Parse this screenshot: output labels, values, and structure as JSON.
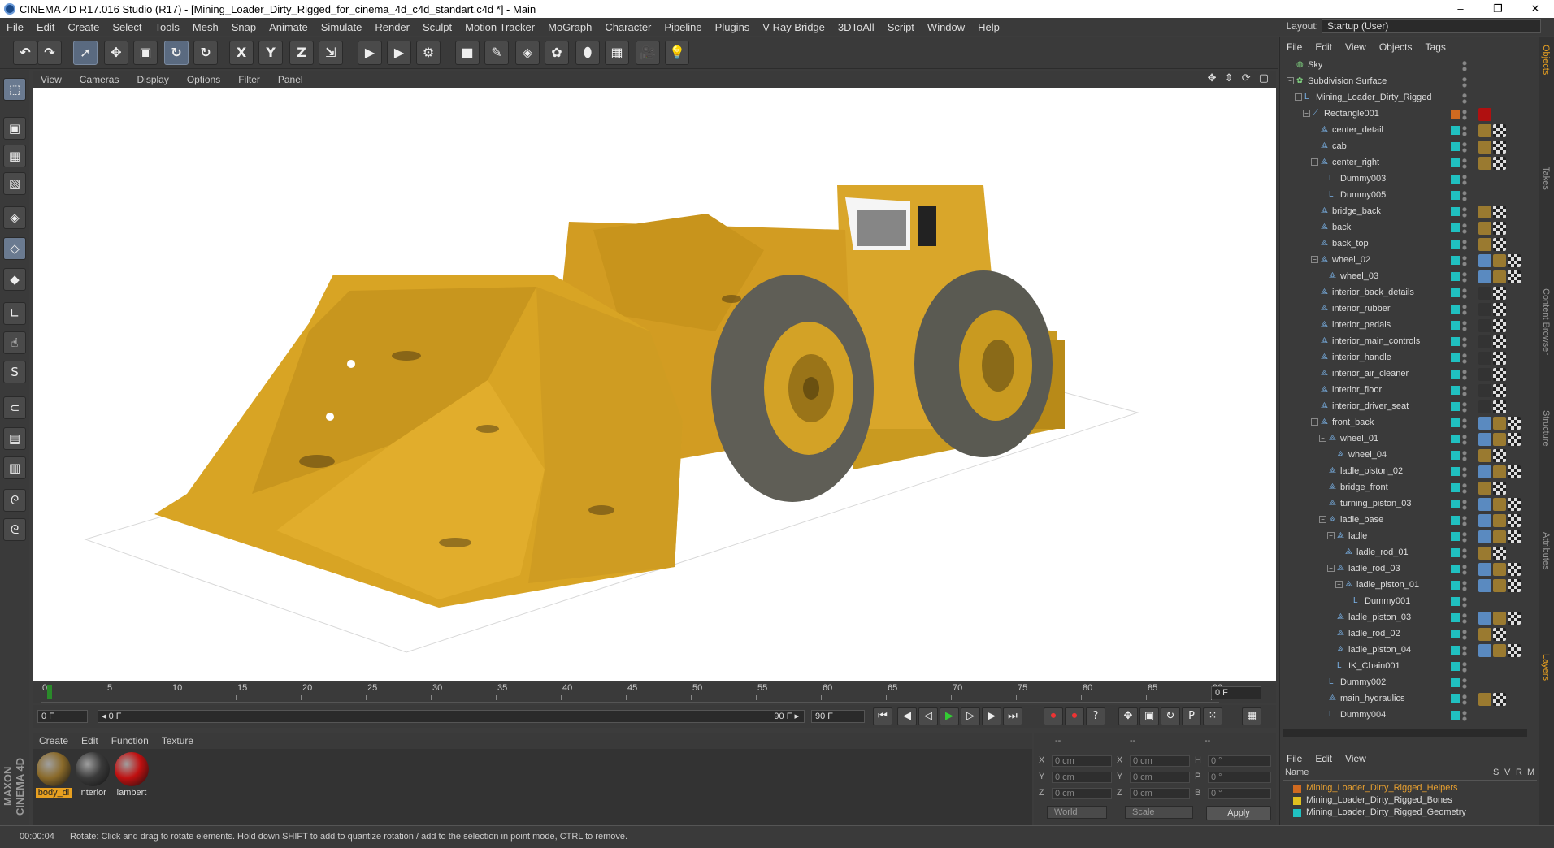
{
  "window": {
    "title": "CINEMA 4D R17.016 Studio (R17) - [Mining_Loader_Dirty_Rigged_for_cinema_4d_c4d_standart.c4d *] - Main",
    "controls": [
      "–",
      "❐",
      "✕"
    ]
  },
  "menubar": [
    "File",
    "Edit",
    "Create",
    "Select",
    "Tools",
    "Mesh",
    "Snap",
    "Animate",
    "Simulate",
    "Render",
    "Sculpt",
    "Motion Tracker",
    "MoGraph",
    "Character",
    "Pipeline",
    "Plugins",
    "V-Ray Bridge",
    "3DToAll",
    "Script",
    "Window",
    "Help"
  ],
  "layout": {
    "label": "Layout:",
    "value": "Startup (User)"
  },
  "toolbar": {
    "icons": [
      "undo-icon",
      "redo-icon",
      "live-select-icon",
      "move-icon",
      "scale-icon",
      "rotate-icon",
      "recent-tool-icon",
      "x-axis-icon",
      "y-axis-icon",
      "z-axis-icon",
      "coordinate-system-icon",
      "render-view-icon",
      "render-picture-viewer-icon",
      "edit-render-settings-icon",
      "cube-icon",
      "pen-icon",
      "subdivision-icon",
      "cloner-icon",
      "deformer-icon",
      "floor-icon",
      "camera-icon",
      "light-icon"
    ],
    "glyphs": [
      "↶",
      "↷",
      "➚",
      "✥",
      "▣",
      "↻",
      "↻",
      "X",
      "Y",
      "Z",
      "⇲",
      "▶",
      "▶",
      "⚙",
      "■",
      "✎",
      "◈",
      "✿",
      "⬮",
      "▦",
      "🎥",
      "💡"
    ]
  },
  "left_tools": {
    "icons": [
      "model-mode-icon",
      "make-editable-icon",
      "texture-mode-icon",
      "workplane-icon",
      "points-mode-icon",
      "edges-mode-icon",
      "polygons-mode-icon",
      "axis-mode-icon",
      "tweak-mode-icon",
      "solo-icon",
      "snap-icon",
      "workplane-lock-icon",
      "grid-snap-icon",
      "python-icon",
      "python-script-icon"
    ],
    "glyphs": [
      "⬚",
      "▣",
      "▦",
      "▧",
      "◈",
      "◇",
      "◆",
      "∟",
      "☝",
      "S",
      "⊂",
      "▤",
      "▥",
      "ᘓ",
      "ᘓ"
    ]
  },
  "maxon_logo": "MAXON CINEMA 4D",
  "viewport": {
    "menu": [
      "View",
      "Cameras",
      "Display",
      "Options",
      "Filter",
      "Panel"
    ],
    "nav_icons": "✥ ⇕ ⟳ ▢"
  },
  "timeline": {
    "ticks": [
      "0",
      "5",
      "10",
      "15",
      "20",
      "25",
      "30",
      "35",
      "40",
      "45",
      "50",
      "55",
      "60",
      "65",
      "70",
      "75",
      "80",
      "85",
      "90"
    ],
    "current_frame": "0 F"
  },
  "transport": {
    "start_frame": "0 F",
    "range_start": "◂ 0 F",
    "range_end": "90 F ▸",
    "end_frame": "90 F",
    "buttons": [
      "⏮",
      "◀",
      "◁",
      "▶",
      "▷",
      "▶",
      "⏭",
      "⏺",
      "⏺",
      "?",
      "✥",
      "▣",
      "↻",
      "P",
      "⁙",
      "▦"
    ]
  },
  "materials": {
    "menu": [
      "Create",
      "Edit",
      "Function",
      "Texture"
    ],
    "items": [
      {
        "name": "body_di",
        "color": "#8a6a2a"
      },
      {
        "name": "interior",
        "color": "#3a3a3a"
      },
      {
        "name": "lambert",
        "color": "#c01010"
      }
    ]
  },
  "coords": {
    "header": [
      "--",
      "--",
      "--"
    ],
    "rows": [
      {
        "a": "X",
        "av": "0 cm",
        "b": "X",
        "bv": "0 cm",
        "c": "H",
        "cv": "0 °"
      },
      {
        "a": "Y",
        "av": "0 cm",
        "b": "Y",
        "bv": "0 cm",
        "c": "P",
        "cv": "0 °"
      },
      {
        "a": "Z",
        "av": "0 cm",
        "b": "Z",
        "bv": "0 cm",
        "c": "B",
        "cv": "0 °"
      }
    ],
    "world": "World",
    "scale": "Scale",
    "apply": "Apply"
  },
  "status": {
    "time": "00:00:04",
    "text": "Rotate: Click and drag to rotate elements. Hold down SHIFT to add to quantize rotation / add to the selection in point mode, CTRL to remove."
  },
  "object_manager": {
    "menu": [
      "File",
      "Edit",
      "View",
      "Objects",
      "Tags"
    ],
    "objects": [
      {
        "name": "Sky",
        "depth": 0,
        "icon": "sky-icon",
        "expand": "",
        "layer": "",
        "tags": []
      },
      {
        "name": "Subdivision Surface",
        "depth": 0,
        "icon": "subdivision-icon",
        "expand": "−",
        "layer": "",
        "tags": []
      },
      {
        "name": "Mining_Loader_Dirty_Rigged",
        "depth": 1,
        "icon": "null-icon",
        "expand": "−",
        "layer": "",
        "tags": []
      },
      {
        "name": "Rectangle001",
        "depth": 2,
        "icon": "spline-icon",
        "expand": "−",
        "layer": "#d06a20",
        "tags": [
          "#b01010"
        ]
      },
      {
        "name": "center_detail",
        "depth": 3,
        "icon": "bone-icon",
        "expand": "",
        "layer": "#20c0c0",
        "tags": [
          "#9a7a30",
          "#ddd"
        ]
      },
      {
        "name": "cab",
        "depth": 3,
        "icon": "bone-icon",
        "expand": "",
        "layer": "#20c0c0",
        "tags": [
          "#9a7a30",
          "#ddd"
        ]
      },
      {
        "name": "center_right",
        "depth": 3,
        "icon": "bone-icon",
        "expand": "−",
        "layer": "#20c0c0",
        "tags": [
          "#9a7a30",
          "#ddd"
        ]
      },
      {
        "name": "Dummy003",
        "depth": 4,
        "icon": "null-icon",
        "expand": "",
        "layer": "#20c0c0",
        "tags": []
      },
      {
        "name": "Dummy005",
        "depth": 4,
        "icon": "null-icon",
        "expand": "",
        "layer": "#20c0c0",
        "tags": []
      },
      {
        "name": "bridge_back",
        "depth": 3,
        "icon": "bone-icon",
        "expand": "",
        "layer": "#20c0c0",
        "tags": [
          "#9a7a30",
          "#ddd"
        ]
      },
      {
        "name": "back",
        "depth": 3,
        "icon": "bone-icon",
        "expand": "",
        "layer": "#20c0c0",
        "tags": [
          "#9a7a30",
          "#ddd"
        ]
      },
      {
        "name": "back_top",
        "depth": 3,
        "icon": "bone-icon",
        "expand": "",
        "layer": "#20c0c0",
        "tags": [
          "#9a7a30",
          "#ddd"
        ]
      },
      {
        "name": "wheel_02",
        "depth": 3,
        "icon": "bone-icon",
        "expand": "−",
        "layer": "#20c0c0",
        "tags": [
          "#5a8ac0",
          "#9a7a30",
          "#ddd"
        ]
      },
      {
        "name": "wheel_03",
        "depth": 4,
        "icon": "bone-icon",
        "expand": "",
        "layer": "#20c0c0",
        "tags": [
          "#5a8ac0",
          "#9a7a30",
          "#ddd"
        ]
      },
      {
        "name": "interior_back_details",
        "depth": 3,
        "icon": "bone-icon",
        "expand": "",
        "layer": "#20c0c0",
        "tags": [
          "#333",
          "#ddd"
        ]
      },
      {
        "name": "interior_rubber",
        "depth": 3,
        "icon": "bone-icon",
        "expand": "",
        "layer": "#20c0c0",
        "tags": [
          "#333",
          "#ddd"
        ]
      },
      {
        "name": "interior_pedals",
        "depth": 3,
        "icon": "bone-icon",
        "expand": "",
        "layer": "#20c0c0",
        "tags": [
          "#333",
          "#ddd"
        ]
      },
      {
        "name": "interior_main_controls",
        "depth": 3,
        "icon": "bone-icon",
        "expand": "",
        "layer": "#20c0c0",
        "tags": [
          "#333",
          "#ddd"
        ]
      },
      {
        "name": "interior_handle",
        "depth": 3,
        "icon": "bone-icon",
        "expand": "",
        "layer": "#20c0c0",
        "tags": [
          "#333",
          "#ddd"
        ]
      },
      {
        "name": "interior_air_cleaner",
        "depth": 3,
        "icon": "bone-icon",
        "expand": "",
        "layer": "#20c0c0",
        "tags": [
          "#333",
          "#ddd"
        ]
      },
      {
        "name": "interior_floor",
        "depth": 3,
        "icon": "bone-icon",
        "expand": "",
        "layer": "#20c0c0",
        "tags": [
          "#333",
          "#ddd"
        ]
      },
      {
        "name": "interior_driver_seat",
        "depth": 3,
        "icon": "bone-icon",
        "expand": "",
        "layer": "#20c0c0",
        "tags": [
          "#333",
          "#ddd"
        ]
      },
      {
        "name": "front_back",
        "depth": 3,
        "icon": "bone-icon",
        "expand": "−",
        "layer": "#20c0c0",
        "tags": [
          "#5a8ac0",
          "#9a7a30",
          "#ddd"
        ]
      },
      {
        "name": "wheel_01",
        "depth": 4,
        "icon": "bone-icon",
        "expand": "−",
        "layer": "#20c0c0",
        "tags": [
          "#5a8ac0",
          "#9a7a30",
          "#ddd"
        ]
      },
      {
        "name": "wheel_04",
        "depth": 5,
        "icon": "bone-icon",
        "expand": "",
        "layer": "#20c0c0",
        "tags": [
          "#9a7a30",
          "#ddd"
        ]
      },
      {
        "name": "ladle_piston_02",
        "depth": 4,
        "icon": "bone-icon",
        "expand": "",
        "layer": "#20c0c0",
        "tags": [
          "#5a8ac0",
          "#9a7a30",
          "#ddd"
        ]
      },
      {
        "name": "bridge_front",
        "depth": 4,
        "icon": "bone-icon",
        "expand": "",
        "layer": "#20c0c0",
        "tags": [
          "#9a7a30",
          "#ddd"
        ]
      },
      {
        "name": "turning_piston_03",
        "depth": 4,
        "icon": "bone-icon",
        "expand": "",
        "layer": "#20c0c0",
        "tags": [
          "#5a8ac0",
          "#9a7a30",
          "#ddd"
        ]
      },
      {
        "name": "ladle_base",
        "depth": 4,
        "icon": "bone-icon",
        "expand": "−",
        "layer": "#20c0c0",
        "tags": [
          "#5a8ac0",
          "#9a7a30",
          "#ddd"
        ]
      },
      {
        "name": "ladle",
        "depth": 5,
        "icon": "bone-icon",
        "expand": "−",
        "layer": "#20c0c0",
        "tags": [
          "#5a8ac0",
          "#9a7a30",
          "#ddd"
        ]
      },
      {
        "name": "ladle_rod_01",
        "depth": 6,
        "icon": "bone-icon",
        "expand": "",
        "layer": "#20c0c0",
        "tags": [
          "#9a7a30",
          "#ddd"
        ]
      },
      {
        "name": "ladle_rod_03",
        "depth": 5,
        "icon": "bone-icon",
        "expand": "−",
        "layer": "#20c0c0",
        "tags": [
          "#5a8ac0",
          "#9a7a30",
          "#ddd"
        ]
      },
      {
        "name": "ladle_piston_01",
        "depth": 6,
        "icon": "bone-icon",
        "expand": "−",
        "layer": "#20c0c0",
        "tags": [
          "#5a8ac0",
          "#9a7a30",
          "#ddd"
        ]
      },
      {
        "name": "Dummy001",
        "depth": 7,
        "icon": "null-icon",
        "expand": "",
        "layer": "#20c0c0",
        "tags": []
      },
      {
        "name": "ladle_piston_03",
        "depth": 5,
        "icon": "bone-icon",
        "expand": "",
        "layer": "#20c0c0",
        "tags": [
          "#5a8ac0",
          "#9a7a30",
          "#ddd"
        ]
      },
      {
        "name": "ladle_rod_02",
        "depth": 5,
        "icon": "bone-icon",
        "expand": "",
        "layer": "#20c0c0",
        "tags": [
          "#9a7a30",
          "#ddd"
        ]
      },
      {
        "name": "ladle_piston_04",
        "depth": 5,
        "icon": "bone-icon",
        "expand": "",
        "layer": "#20c0c0",
        "tags": [
          "#5a8ac0",
          "#9a7a30",
          "#ddd"
        ]
      },
      {
        "name": "IK_Chain001",
        "depth": 5,
        "icon": "null-icon",
        "expand": "",
        "layer": "#20c0c0",
        "tags": []
      },
      {
        "name": "Dummy002",
        "depth": 4,
        "icon": "null-icon",
        "expand": "",
        "layer": "#20c0c0",
        "tags": []
      },
      {
        "name": "main_hydraulics",
        "depth": 4,
        "icon": "bone-icon",
        "expand": "",
        "layer": "#20c0c0",
        "tags": [
          "#9a7a30",
          "#ddd"
        ]
      },
      {
        "name": "Dummy004",
        "depth": 4,
        "icon": "null-icon",
        "expand": "",
        "layer": "#20c0c0",
        "tags": []
      }
    ]
  },
  "layer_manager": {
    "menu": [
      "File",
      "Edit",
      "View"
    ],
    "columns": [
      "Name",
      "S",
      "V",
      "R",
      "M"
    ],
    "layers": [
      {
        "name": "Mining_Loader_Dirty_Rigged_Helpers",
        "color": "#d06a20",
        "text_color": "#e8a030"
      },
      {
        "name": "Mining_Loader_Dirty_Rigged_Bones",
        "color": "#e0c020",
        "text_color": "#ddd"
      },
      {
        "name": "Mining_Loader_Dirty_Rigged_Geometry",
        "color": "#20c0c0",
        "text_color": "#ddd"
      }
    ]
  },
  "right_tabs": [
    "Objects",
    "Takes",
    "Content Browser",
    "Structure",
    "Attributes",
    "Layers"
  ]
}
